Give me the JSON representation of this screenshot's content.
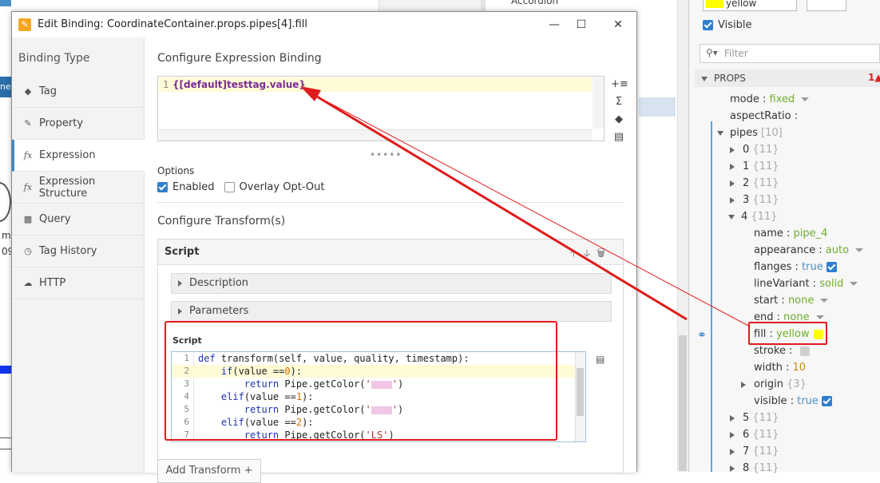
{
  "background": {
    "components_item": "Accordion",
    "left_tab_text": "ne-",
    "left_text1": "m",
    "left_text2": "09"
  },
  "dialog": {
    "title": "Edit Binding: CoordinateContainer.props.pipes[4].fill",
    "sidebar_title": "Binding Type",
    "sidebar_items": [
      {
        "label": "Tag",
        "icon": "tag-icon"
      },
      {
        "label": "Property",
        "icon": "property-icon"
      },
      {
        "label": "Expression",
        "icon": "fx-icon",
        "active": true
      },
      {
        "label": "Expression Structure",
        "icon": "fx-icon"
      },
      {
        "label": "Query",
        "icon": "database-icon"
      },
      {
        "label": "Tag History",
        "icon": "clock-icon"
      },
      {
        "label": "HTTP",
        "icon": "cloud-icon"
      }
    ],
    "config_heading": "Configure Expression Binding",
    "expression": {
      "line": "1",
      "code": "{[default]testtag.value}"
    },
    "options_label": "Options",
    "options": [
      {
        "label": "Enabled",
        "checked": true
      },
      {
        "label": "Overlay Opt-Out",
        "checked": false
      }
    ],
    "transform_heading": "Configure Transform(s)",
    "script_card_title": "Script",
    "description_label": "Description",
    "parameters_label": "Parameters",
    "script_label": "Script",
    "code_lines": [
      {
        "n": "1",
        "text": "def transform(self, value, quality, timestamp):"
      },
      {
        "n": "2",
        "text": "    if(value ==0):"
      },
      {
        "n": "3",
        "text": "        return Pipe.getColor('"
      },
      {
        "n": "4",
        "text": "    elif(value ==1):"
      },
      {
        "n": "5",
        "text": "        return Pipe.getColor('"
      },
      {
        "n": "6",
        "text": "    elif(value ==2):"
      },
      {
        "n": "7",
        "text": "        return Pipe.getColor('LS')"
      }
    ],
    "add_transform_label": "Add Transform +"
  },
  "props_panel": {
    "top_value": "yellow",
    "visible_label": "Visible",
    "filter_placeholder": "Filter",
    "header": "PROPS",
    "badge": "1",
    "rows": {
      "mode": {
        "key": "mode",
        "val": "fixed"
      },
      "aspect": {
        "key": "aspectRatio",
        "val": ""
      },
      "pipes": {
        "key": "pipes",
        "cnt": "[10]"
      },
      "p0": {
        "key": "0",
        "cnt": "{11}"
      },
      "p1": {
        "key": "1",
        "cnt": "{11}"
      },
      "p2": {
        "key": "2",
        "cnt": "{11}"
      },
      "p3": {
        "key": "3",
        "cnt": "{11}"
      },
      "p4": {
        "key": "4",
        "cnt": "{11}"
      },
      "name": {
        "key": "name",
        "val": "pipe_4"
      },
      "appearance": {
        "key": "appearance",
        "val": "auto"
      },
      "flanges": {
        "key": "flanges",
        "val": "true"
      },
      "lineVariant": {
        "key": "lineVariant",
        "val": "solid"
      },
      "start": {
        "key": "start",
        "val": "none"
      },
      "end": {
        "key": "end",
        "val": "none"
      },
      "fill": {
        "key": "fill",
        "val": "yellow"
      },
      "stroke": {
        "key": "stroke",
        "val": ""
      },
      "width": {
        "key": "width",
        "val": "10"
      },
      "origin": {
        "key": "origin",
        "cnt": "{3}"
      },
      "visible": {
        "key": "visible",
        "val": "true"
      },
      "p5": {
        "key": "5",
        "cnt": "{11}"
      },
      "p6": {
        "key": "6",
        "cnt": "{11}"
      },
      "p7": {
        "key": "7",
        "cnt": "{11}"
      },
      "p8": {
        "key": "8",
        "cnt": "{11}"
      }
    }
  }
}
